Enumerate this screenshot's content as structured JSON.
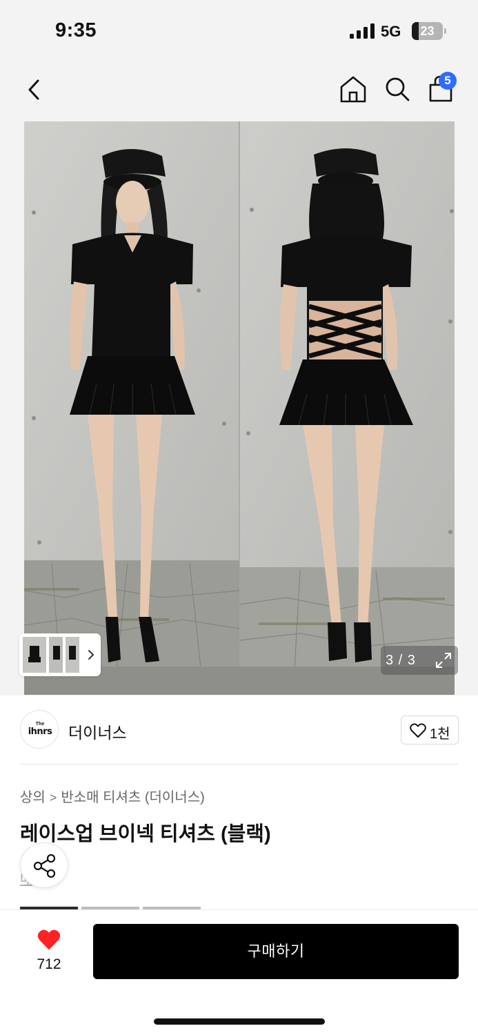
{
  "status_bar": {
    "time": "9:35",
    "network": "5G",
    "battery": "23",
    "battery_level": 0.23
  },
  "header": {
    "cart_count": "5",
    "icons": [
      "back-icon",
      "home-icon",
      "search-icon",
      "cart-icon"
    ]
  },
  "gallery": {
    "counter": "3 / 3",
    "thumbnail_count": 3
  },
  "brand": {
    "logo_small": "The",
    "logo_text": "ihnrs",
    "name": "더이너스",
    "likes": "1천"
  },
  "breadcrumb": {
    "category": "상의",
    "subcategory": "반소매 티셔츠 (더이너스)"
  },
  "product": {
    "title": "레이스업 브이넥 티셔츠 (블랙)",
    "link_text": "매"
  },
  "bottom": {
    "wish_count": "712",
    "buy_label": "구매하기"
  },
  "colors": {
    "accent": "#2f6bff",
    "heart": "#ff2222",
    "buy_button": "#000000"
  }
}
